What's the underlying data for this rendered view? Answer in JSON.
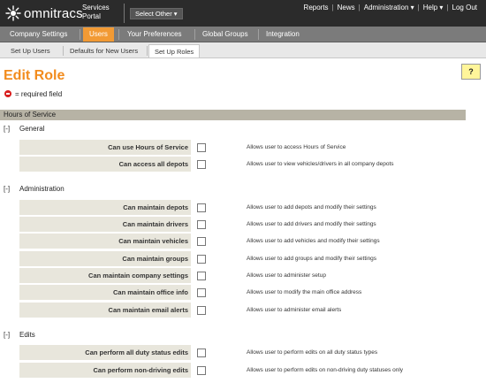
{
  "header": {
    "logo_text": "omnitracs",
    "portal_line1": "Services",
    "portal_line2": "Portal",
    "select_other": "Select Other ▾",
    "links": [
      "Reports",
      "News",
      "Administration ▾",
      "Help ▾",
      "Log Out"
    ]
  },
  "main_tabs": [
    {
      "label": "Company Settings",
      "active": false
    },
    {
      "label": "Users",
      "active": true
    },
    {
      "label": "Your Preferences",
      "active": false
    },
    {
      "label": "Global Groups",
      "active": false
    },
    {
      "label": "Integration",
      "active": false
    }
  ],
  "sub_tabs": [
    {
      "label": "Set Up Users",
      "active": false
    },
    {
      "label": "Defaults for New Users",
      "active": false
    },
    {
      "label": "Set Up Roles",
      "active": true
    }
  ],
  "page": {
    "title": "Edit Role",
    "help": "?",
    "required_note": "= required field"
  },
  "section": {
    "title": "Hours of Service",
    "groups": [
      {
        "toggle": "[-]",
        "title": "General",
        "items": [
          {
            "label": "Can use Hours of Service",
            "desc": "Allows user to access Hours of Service"
          },
          {
            "label": "Can access all depots",
            "desc": "Allows user to view vehicles/drivers in all company depots"
          }
        ]
      },
      {
        "toggle": "[-]",
        "title": "Administration",
        "items": [
          {
            "label": "Can maintain depots",
            "desc": "Allows user to add depots and modify their settings"
          },
          {
            "label": "Can maintain drivers",
            "desc": "Allows user to add drivers and modify their settings"
          },
          {
            "label": "Can maintain vehicles",
            "desc": "Allows user to add vehicles and modify their settings"
          },
          {
            "label": "Can maintain groups",
            "desc": "Allows user to add groups and modify their settings"
          },
          {
            "label": "Can maintain company settings",
            "desc": "Allows user to administer setup"
          },
          {
            "label": "Can maintain office info",
            "desc": "Allows user to modify the main office address"
          },
          {
            "label": "Can maintain email alerts",
            "desc": "Allows user to administer email alerts"
          }
        ]
      },
      {
        "toggle": "[-]",
        "title": "Edits",
        "items": [
          {
            "label": "Can perform all duty status edits",
            "desc": "Allows user to perform edits on all duty status types"
          },
          {
            "label": "Can perform non-driving edits",
            "desc": "Allows user to perform edits on non-driving duty statuses only"
          }
        ]
      }
    ]
  },
  "colors": {
    "topbar": "#2b2b2b",
    "accent_orange": "#f28c1e",
    "active_tab": "#f29a34",
    "section_bar": "#b7b3a5",
    "label_bg": "#e8e6dc"
  }
}
